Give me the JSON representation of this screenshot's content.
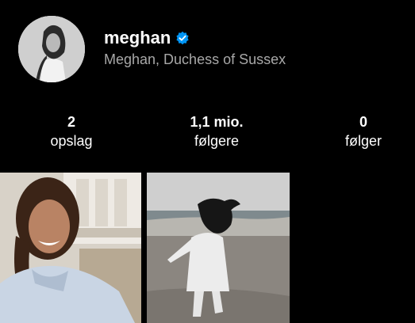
{
  "profile": {
    "username": "meghan",
    "full_name": "Meghan, Duchess of Sussex",
    "verified": true,
    "avatar_icon": "profile-photo"
  },
  "stats": [
    {
      "value": "2",
      "label": "opslag"
    },
    {
      "value": "1,1 mio.",
      "label": "følgere"
    },
    {
      "value": "0",
      "label": "følger"
    }
  ],
  "posts": [
    {
      "icon": "photo-woman-smiling-kitchen"
    },
    {
      "icon": "photo-woman-running-beach"
    }
  ],
  "colors": {
    "background": "#000000",
    "text": "#ffffff",
    "secondary_text": "#a8a8a8",
    "verified_badge": "#0095f6"
  }
}
